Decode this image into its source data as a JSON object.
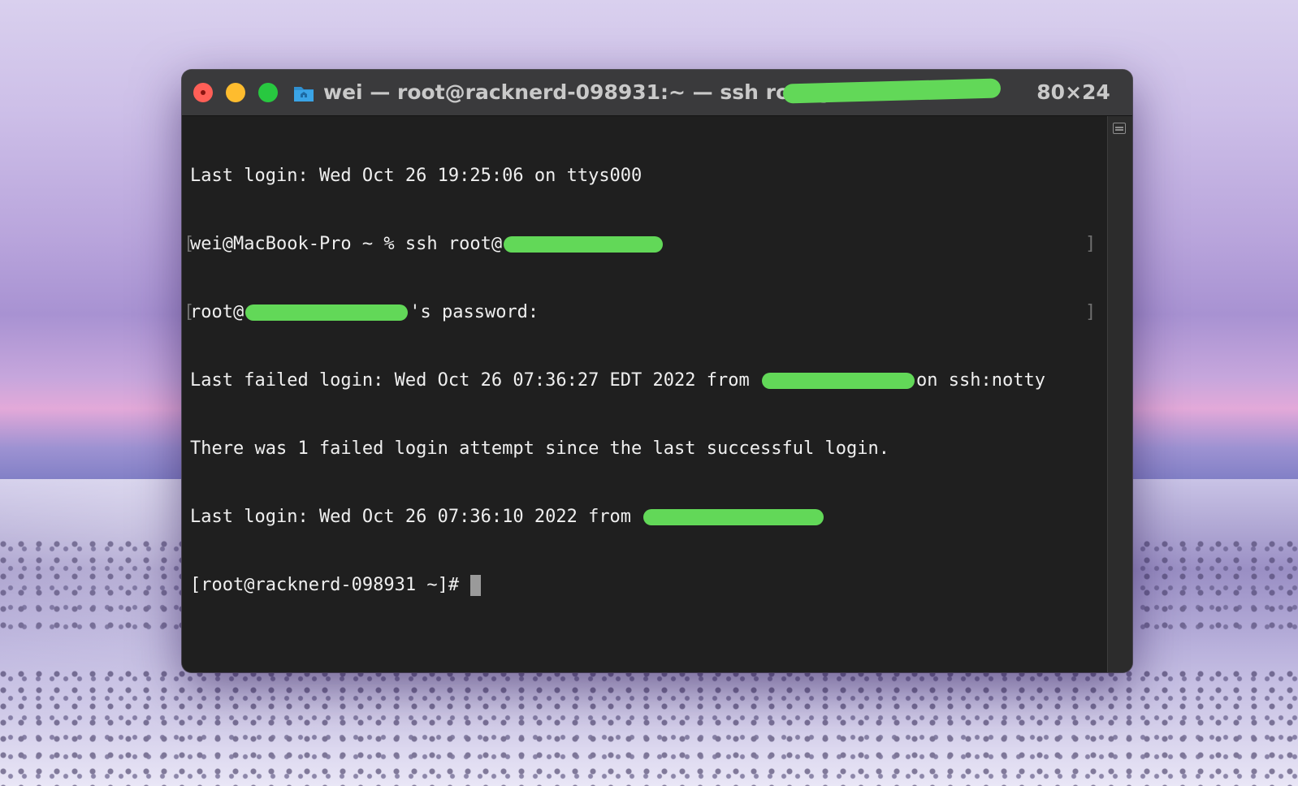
{
  "window": {
    "title_before": "wei — root@racknerd-098931:~ — ssh root@",
    "title_after": "80×24"
  },
  "terminal": {
    "line1": "Last login: Wed Oct 26 19:25:06 on ttys000",
    "line2_before": "wei@MacBook-Pro ~ % ssh root@",
    "line3_before": "root@",
    "line3_after": "'s password:",
    "line4_before": "Last failed login: Wed Oct 26 07:36:27 EDT 2022 from ",
    "line4_after": "on ssh:notty",
    "line5": "There was 1 failed login attempt since the last successful login.",
    "line6_before": "Last login: Wed Oct 26 07:36:10 2022 from ",
    "prompt": "[root@racknerd-098931 ~]#"
  },
  "colors": {
    "redaction": "#62d858",
    "terminal_background": "#1f1f1f",
    "terminal_text": "#efefef"
  }
}
